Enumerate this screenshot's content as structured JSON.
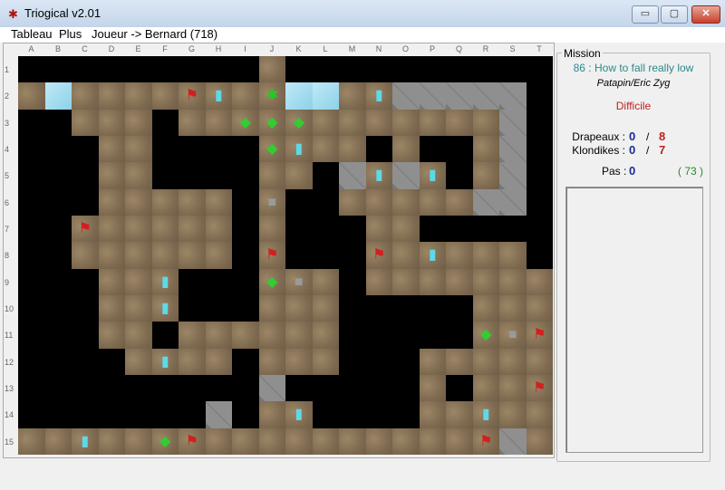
{
  "window": {
    "title": "Triogical v2.01",
    "minimize": "▭",
    "maximize": "▢",
    "close": "✕"
  },
  "menu": [
    "Tableau",
    "Plus",
    "Joueur -> Bernard (718)"
  ],
  "columns": [
    "A",
    "B",
    "C",
    "D",
    "E",
    "F",
    "G",
    "H",
    "I",
    "J",
    "K",
    "L",
    "M",
    "N",
    "O",
    "P",
    "Q",
    "R",
    "S",
    "T"
  ],
  "rows": [
    "1",
    "2",
    "3",
    "4",
    "5",
    "6",
    "7",
    "8",
    "9",
    "10",
    "11",
    "12",
    "13",
    "14",
    "15"
  ],
  "board_map": [
    "#########.##########",
    ".i........ii..sssss#",
    "##...#............s#",
    "###..####....#.##.s#",
    "###..####..#s.s.#.s#",
    "###.....#.##.....ss#",
    "##......#.###..#####",
    "##......#.###......#",
    "###...###...#.......",
    "###...###...#####...",
    "###..#......#####...",
    "####....#...###.....",
    "#########s#####.#...",
    "#######s#..####.....",
    "..................s."
  ],
  "items": [
    {
      "type": "flag",
      "col": 6,
      "row": 1
    },
    {
      "type": "flag",
      "col": 2,
      "row": 6
    },
    {
      "type": "flag",
      "col": 9,
      "row": 7
    },
    {
      "type": "flag",
      "col": 13,
      "row": 7
    },
    {
      "type": "flag",
      "col": 19,
      "row": 10
    },
    {
      "type": "flag",
      "col": 19,
      "row": 12
    },
    {
      "type": "flag",
      "col": 6,
      "row": 14
    },
    {
      "type": "flag",
      "col": 17,
      "row": 14
    },
    {
      "type": "gem",
      "col": 8,
      "row": 2
    },
    {
      "type": "gem",
      "col": 9,
      "row": 2
    },
    {
      "type": "gem",
      "col": 10,
      "row": 2
    },
    {
      "type": "gem",
      "col": 9,
      "row": 3
    },
    {
      "type": "gem",
      "col": 9,
      "row": 8
    },
    {
      "type": "gem",
      "col": 17,
      "row": 10
    },
    {
      "type": "gem",
      "col": 5,
      "row": 14
    },
    {
      "type": "bar",
      "col": 7,
      "row": 1
    },
    {
      "type": "bar",
      "col": 13,
      "row": 1
    },
    {
      "type": "bar",
      "col": 10,
      "row": 3
    },
    {
      "type": "bar",
      "col": 13,
      "row": 4
    },
    {
      "type": "bar",
      "col": 15,
      "row": 4
    },
    {
      "type": "bar",
      "col": 15,
      "row": 7
    },
    {
      "type": "bar",
      "col": 5,
      "row": 8
    },
    {
      "type": "bar",
      "col": 5,
      "row": 9
    },
    {
      "type": "bar",
      "col": 5,
      "row": 11
    },
    {
      "type": "bar",
      "col": 17,
      "row": 13
    },
    {
      "type": "bar",
      "col": 10,
      "row": 13
    },
    {
      "type": "bar",
      "col": 2,
      "row": 14
    },
    {
      "type": "block",
      "col": 9,
      "row": 5
    },
    {
      "type": "block",
      "col": 10,
      "row": 8
    },
    {
      "type": "block",
      "col": 18,
      "row": 10
    },
    {
      "type": "player",
      "col": 9,
      "row": 1
    }
  ],
  "item_glyphs": {
    "flag": "⚑",
    "gem": "◆",
    "bar": "▮",
    "block": "■",
    "player": "✱"
  },
  "item_colors": {
    "flag": "#d02020",
    "gem": "#33cc33",
    "bar": "#5fd8e8",
    "block": "#9a9a9a",
    "player": "#22cc22"
  },
  "mission": {
    "legend": "Mission",
    "title": "86 : How to fall really low",
    "authors": "Patapin/Eric Zyg",
    "difficulty": "Difficile",
    "drapeaux_label": "Drapeaux :",
    "drapeaux_current": "0",
    "drapeaux_total": "8",
    "klondikes_label": "Klondikes :",
    "klondikes_current": "0",
    "klondikes_total": "7",
    "separator": "/",
    "pas_label": "Pas :",
    "pas_value": "0",
    "pas_target": "( 73 )"
  },
  "colors": {
    "title": "#2a8a8a",
    "difficulty": "#c02020",
    "current": "#1a2a9a",
    "total": "#c02020",
    "target": "#2a8a2a"
  }
}
